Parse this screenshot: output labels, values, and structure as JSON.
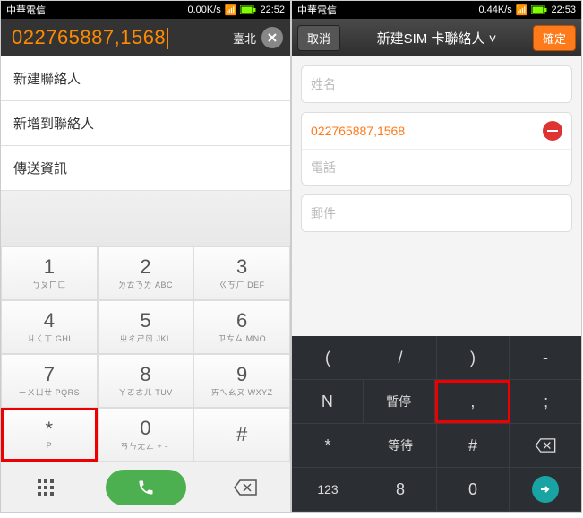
{
  "left": {
    "status": {
      "carrier": "中華電信",
      "speed": "0.00K/s",
      "time": "22:52"
    },
    "dialed": "022765887,1568",
    "region": "臺北",
    "menu": [
      "新建聯絡人",
      "新增到聯絡人",
      "傳送資訊"
    ],
    "keys": [
      {
        "n": "1",
        "s": "ㄅㄆㄇㄈ"
      },
      {
        "n": "2",
        "s": "ㄉㄊㄋㄌ ABC"
      },
      {
        "n": "3",
        "s": "ㄍㄎㄏ DEF"
      },
      {
        "n": "4",
        "s": "ㄐㄑㄒ GHI"
      },
      {
        "n": "5",
        "s": "ㄓㄔㄕㄖ JKL"
      },
      {
        "n": "6",
        "s": "ㄗㄘㄙ MNO"
      },
      {
        "n": "7",
        "s": "ㄧㄨㄩㄝ PQRS"
      },
      {
        "n": "8",
        "s": "ㄚㄛㄜㄦ TUV"
      },
      {
        "n": "9",
        "s": "ㄞㄟㄠㄡ WXYZ"
      },
      {
        "n": "*",
        "s": "P"
      },
      {
        "n": "0",
        "s": "ㄢㄣㄤㄥ +﹣"
      },
      {
        "n": "#",
        "s": ""
      }
    ]
  },
  "right": {
    "status": {
      "carrier": "中華電信",
      "speed": "0.44K/s",
      "time": "22:53"
    },
    "nav": {
      "cancel": "取消",
      "title": "新建SIM 卡聯絡人 ˅",
      "ok": "確定"
    },
    "form": {
      "name_placeholder": "姓名",
      "phone_value": "022765887,1568",
      "phone_placeholder": "電話",
      "email_placeholder": "郵件"
    },
    "keyboard": {
      "r1": [
        "(",
        "/",
        ")",
        "-"
      ],
      "r2": [
        "N",
        "暫停",
        ",",
        ";"
      ],
      "r3": [
        "*",
        "等待",
        "#",
        "⌫"
      ],
      "r4": [
        "123",
        "8",
        "0",
        "→"
      ]
    }
  }
}
